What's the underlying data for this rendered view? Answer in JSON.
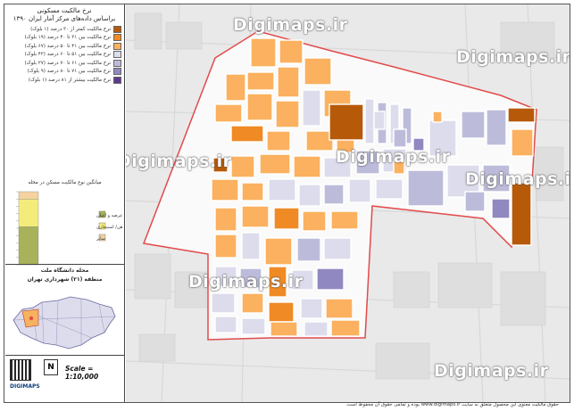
{
  "legend": {
    "title_line1": "نرخ مالکیت مسکونی",
    "title_line2": "براساس داده‌های مرکز آمار ایران ۱۳۹۰",
    "items": [
      {
        "label": "نرخ مالکیت کمتر از ۳۰ درصد (۱ بلوک)",
        "color": "#b65a0a"
      },
      {
        "label": "نرخ مالکیت بین ۳۱ تا ۴۰ درصد (۱۹ بلوک)",
        "color": "#f08a24"
      },
      {
        "label": "نرخ مالکیت بین ۴۱ تا ۵۰ درصد (۶۷ بلوک)",
        "color": "#fbb15f"
      },
      {
        "label": "نرخ مالکیت بین ۵۱ تا ۶۰ درصد (۴۲ بلوک)",
        "color": "#dcdcec"
      },
      {
        "label": "نرخ مالکیت بین ۶۱ تا ۷۰ درصد (۲۷ بلوک)",
        "color": "#bcbcda"
      },
      {
        "label": "نرخ مالکیت بین ۷۱ تا ۸۰ درصد (۹ بلوک)",
        "color": "#9088c0"
      },
      {
        "label": "نرخ مالکیت بیشتر از ۸۱ درصد (۱ بلوک)",
        "color": "#5b3a8c"
      }
    ]
  },
  "bar_chart": {
    "title": "میانگین نوع مالکیت مسکن در محله",
    "items": [
      {
        "label": "ملکی عرصه و اعیان",
        "color": "#a8b25a"
      },
      {
        "label": "رهن/ استیجاری",
        "color": "#f4ec7a"
      },
      {
        "label": "سایر",
        "color": "#f5d2a0"
      }
    ],
    "chart_data": {
      "type": "bar",
      "series": [
        {
          "name": "ملکی عرصه و اعیان",
          "values": [
            52
          ]
        },
        {
          "name": "رهن/ استیجاری",
          "values": [
            38
          ]
        },
        {
          "name": "سایر",
          "values": [
            10
          ]
        }
      ],
      "ylim": [
        0,
        100
      ]
    }
  },
  "locator": {
    "neighborhood": "محله دانشگاه ملت",
    "district": "منطقه (۲۱) شهرداری تهران"
  },
  "scale": {
    "text": "Scale = 1:10,000"
  },
  "logo": {
    "text": "DIGIMAPS"
  },
  "watermark": "Digimaps.ir",
  "footer": "حقوق مالکیت معنوی این محصول متعلق به سایت www.digimaps.ir بوده و تمامی حقوق آن محفوظ است.",
  "colors": {
    "boundary": "#e34a4a",
    "background": "#e6e6e6"
  }
}
